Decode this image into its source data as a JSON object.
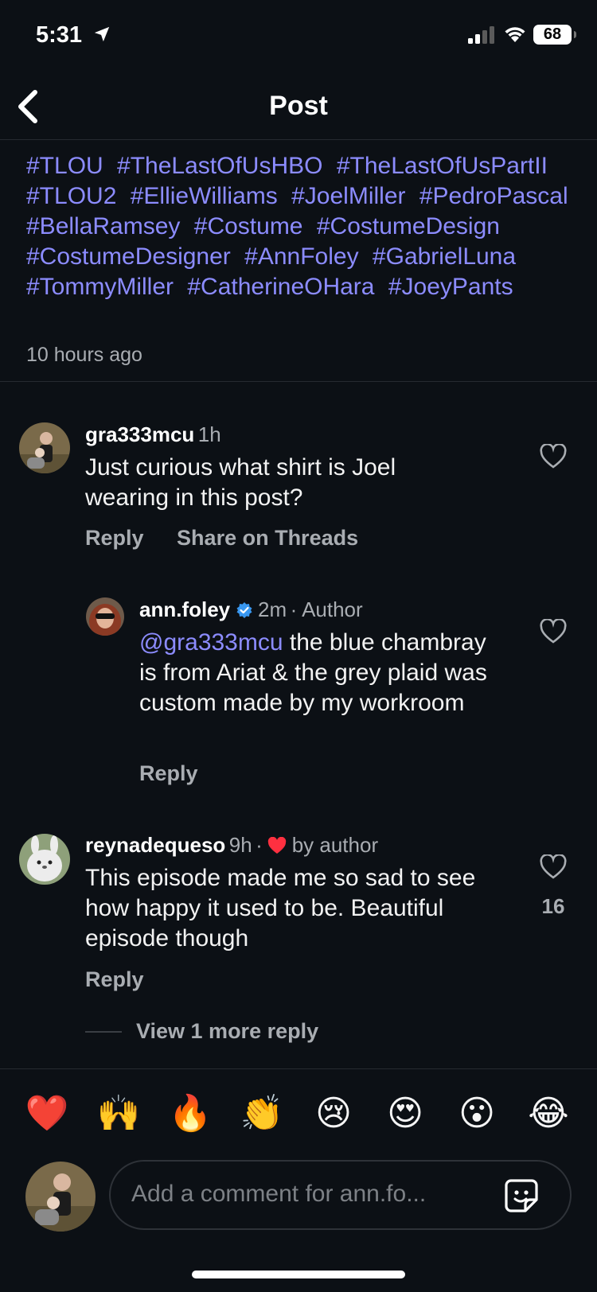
{
  "status_bar": {
    "time": "5:31",
    "battery": "68"
  },
  "header": {
    "title": "Post"
  },
  "caption": {
    "hashtags": [
      "#TLOU",
      "#TheLastOfUsHBO",
      "#TheLastOfUsPartII",
      "#TLOU2",
      "#EllieWilliams",
      "#JoelMiller",
      "#PedroPascal",
      "#BellaRamsey",
      "#Costume",
      "#CostumeDesign",
      "#CostumeDesigner",
      "#AnnFoley",
      "#GabrielLuna",
      "#TommyMiller",
      "#CatherineOHara",
      "#JoeyPants"
    ],
    "time": "10 hours ago"
  },
  "comments": [
    {
      "username": "gra333mcu",
      "time": "1h",
      "text": "Just curious what shirt is Joel wearing in this post?",
      "actions": [
        "Reply",
        "Share on Threads"
      ]
    },
    {
      "username": "ann.foley",
      "time": "2m",
      "badge": "· Author",
      "mention": "@gra333mcu",
      "text": " the blue chambray is from Ariat & the grey plaid was custom made by my workroom",
      "actions": [
        "Reply"
      ]
    },
    {
      "username": "reynadequeso",
      "time": "9h",
      "liked_by": "by author",
      "text": "This episode made me so sad to see how happy it used to be. Beautiful episode though",
      "likes": "16",
      "actions": [
        "Reply"
      ]
    }
  ],
  "view_more": "View 1 more reply",
  "emoji_bar": [
    "❤️",
    "🙌",
    "🔥",
    "👏",
    "😢",
    "😍",
    "😮",
    "😂"
  ],
  "composer": {
    "placeholder": "Add a comment for ann.fo..."
  },
  "colors": {
    "background": "#0c1015",
    "hashtag": "#8c8cff",
    "muted": "#a9adb2",
    "verified": "#3897f0",
    "like_red": "#ff3040"
  }
}
